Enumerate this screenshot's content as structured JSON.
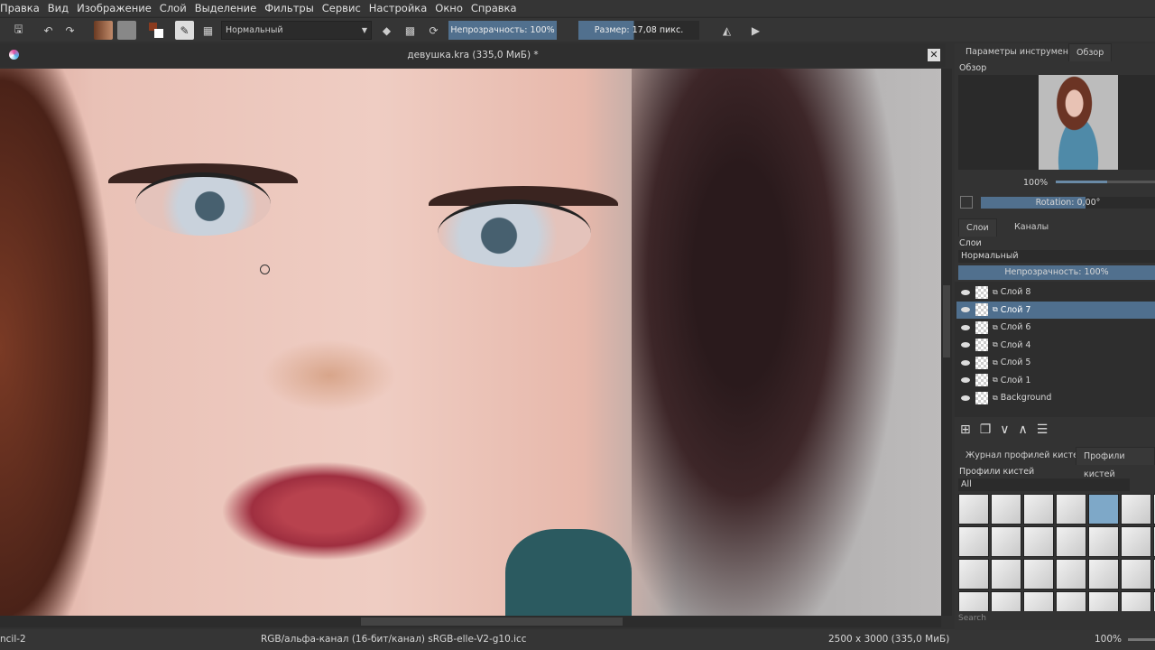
{
  "menu": [
    "Правка",
    "Вид",
    "Изображение",
    "Слой",
    "Выделение",
    "Фильтры",
    "Сервис",
    "Настройка",
    "Окно",
    "Справка"
  ],
  "toolbar": {
    "blend_mode": "Нормальный",
    "opacity": "Непрозрачность:  100%",
    "size": "Размер:  17,08 пикс.",
    "fg_color": "#8a3b1f",
    "bg_color": "#ffffff"
  },
  "document": {
    "title": "девушка.kra (335,0 МиБ) *"
  },
  "panel": {
    "tabs": [
      "Параметры инструмента",
      "Обзор"
    ],
    "overview_label": "Обзор",
    "zoom": "100%",
    "rotation": "Rotation: 0,00°",
    "layer_tabs": [
      "Слои",
      "Каналы"
    ],
    "layers_label": "Слои",
    "blend_mode": "Нормальный",
    "opacity": "Непрозрачность:  100%",
    "layers": [
      {
        "name": "Слой 8",
        "selected": false
      },
      {
        "name": "Слой 7",
        "selected": true
      },
      {
        "name": "Слой 6",
        "selected": false
      },
      {
        "name": "Слой 4",
        "selected": false
      },
      {
        "name": "Слой 5",
        "selected": false
      },
      {
        "name": "Слой 1",
        "selected": false
      },
      {
        "name": "Background",
        "selected": false
      }
    ],
    "brush_tabs": [
      "Журнал профилей кистей",
      "Профили кистей"
    ],
    "brush_label": "Профили кистей",
    "brush_filter": "All",
    "search_placeholder": "Search"
  },
  "status": {
    "brush": "ncil-2",
    "color_space": "RGB/альфа-канал (16-бит/канал)  sRGB-elle-V2-g10.icc",
    "dimensions": "2500 x 3000 (335,0 МиБ)",
    "zoom": "100%"
  }
}
